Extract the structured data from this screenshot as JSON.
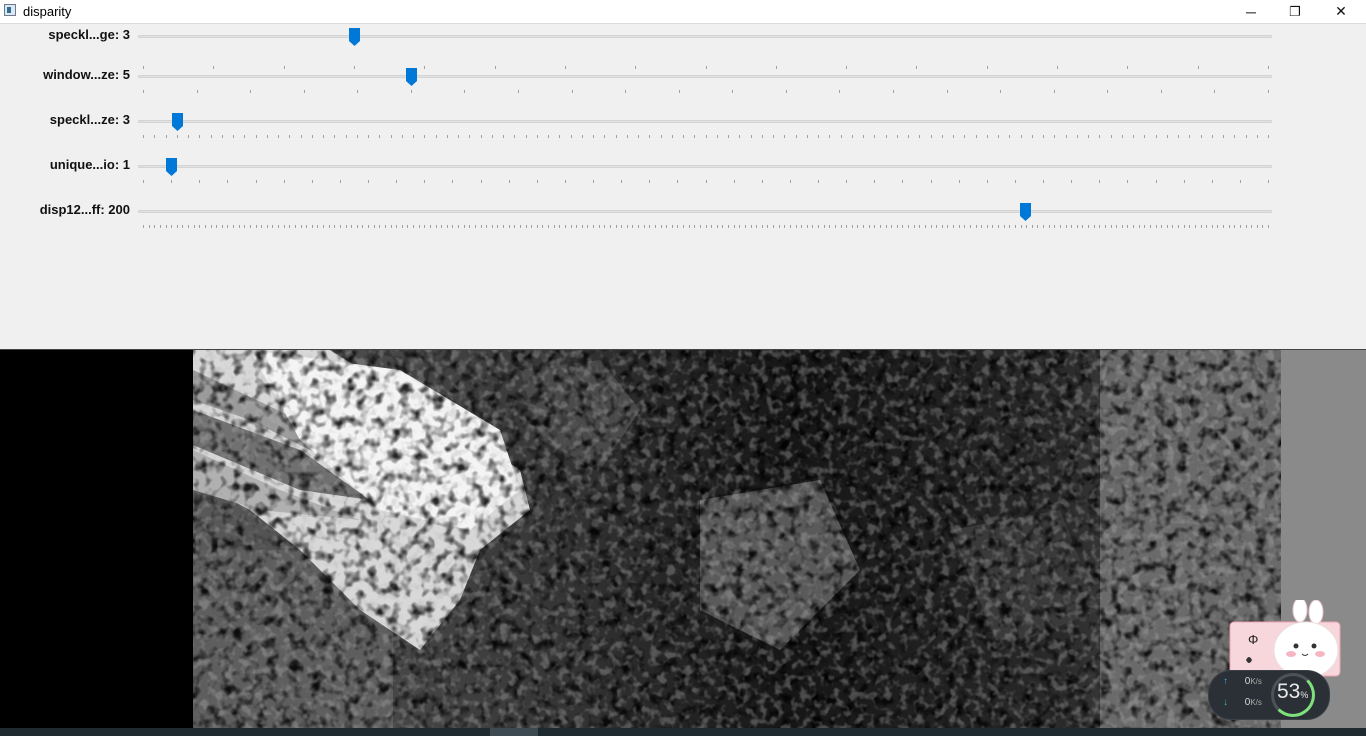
{
  "window": {
    "title": "disparity",
    "controls": {
      "minimize": "─",
      "maximize": "❐",
      "close": "✕"
    }
  },
  "trackbars": [
    {
      "label": "speckl...ge: 3",
      "value": 3,
      "max": 16
    },
    {
      "label": "window...ze: 5",
      "value": 5,
      "max": 21
    },
    {
      "label": "speckl...ze: 3",
      "value": 3,
      "max": 100
    },
    {
      "label": "unique...io: 1",
      "value": 1,
      "max": 40
    },
    {
      "label": "disp12...ff: 200",
      "value": 200,
      "max": 255
    }
  ],
  "system_tray": {
    "upload": "0",
    "upload_unit": "K/s",
    "download": "0",
    "download_unit": "K/s",
    "cpu_value": "53",
    "cpu_unit": "%"
  },
  "widget": {
    "glyph": "Φ"
  },
  "colors": {
    "thumb": "#0078d7",
    "track": "#e2e2e2",
    "tick": "#a0a0a0"
  }
}
